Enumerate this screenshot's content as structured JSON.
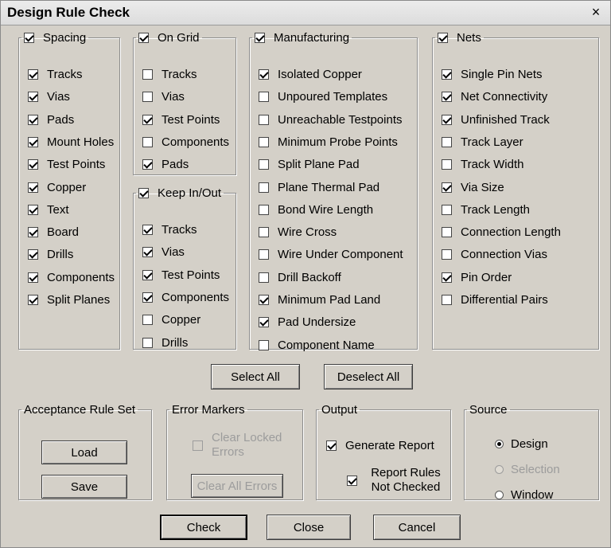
{
  "window": {
    "title": "Design Rule Check",
    "close_glyph": "×"
  },
  "groups": {
    "spacing": {
      "label": "Spacing",
      "checked": true,
      "items": [
        {
          "label": "Tracks",
          "checked": true
        },
        {
          "label": "Vias",
          "checked": true
        },
        {
          "label": "Pads",
          "checked": true
        },
        {
          "label": "Mount Holes",
          "checked": true
        },
        {
          "label": "Test Points",
          "checked": true
        },
        {
          "label": "Copper",
          "checked": true
        },
        {
          "label": "Text",
          "checked": true
        },
        {
          "label": "Board",
          "checked": true
        },
        {
          "label": "Drills",
          "checked": true
        },
        {
          "label": "Components",
          "checked": true
        },
        {
          "label": "Split Planes",
          "checked": true
        }
      ]
    },
    "on_grid": {
      "label": "On Grid",
      "checked": true,
      "items": [
        {
          "label": "Tracks",
          "checked": false
        },
        {
          "label": "Vias",
          "checked": false
        },
        {
          "label": "Test Points",
          "checked": true
        },
        {
          "label": "Components",
          "checked": false
        },
        {
          "label": "Pads",
          "checked": true
        }
      ]
    },
    "keep_in_out": {
      "label": "Keep In/Out",
      "checked": true,
      "items": [
        {
          "label": "Tracks",
          "checked": true
        },
        {
          "label": "Vias",
          "checked": true
        },
        {
          "label": "Test Points",
          "checked": true
        },
        {
          "label": "Components",
          "checked": true
        },
        {
          "label": "Copper",
          "checked": false
        },
        {
          "label": "Drills",
          "checked": false
        }
      ]
    },
    "manufacturing": {
      "label": "Manufacturing",
      "checked": true,
      "items": [
        {
          "label": "Isolated Copper",
          "checked": true
        },
        {
          "label": "Unpoured Templates",
          "checked": false
        },
        {
          "label": "Unreachable Testpoints",
          "checked": false
        },
        {
          "label": "Minimum Probe Points",
          "checked": false
        },
        {
          "label": "Split Plane Pad",
          "checked": false
        },
        {
          "label": "Plane Thermal Pad",
          "checked": false
        },
        {
          "label": "Bond Wire Length",
          "checked": false
        },
        {
          "label": "Wire Cross",
          "checked": false
        },
        {
          "label": "Wire Under Component",
          "checked": false
        },
        {
          "label": "Drill Backoff",
          "checked": false
        },
        {
          "label": "Minimum Pad Land",
          "checked": true
        },
        {
          "label": "Pad Undersize",
          "checked": true
        },
        {
          "label": "Component Name",
          "checked": false
        }
      ]
    },
    "nets": {
      "label": "Nets",
      "checked": true,
      "items": [
        {
          "label": "Single Pin Nets",
          "checked": true
        },
        {
          "label": "Net Connectivity",
          "checked": true
        },
        {
          "label": "Unfinished Track",
          "checked": true
        },
        {
          "label": "Track Layer",
          "checked": false
        },
        {
          "label": "Track Width",
          "checked": false
        },
        {
          "label": "Via Size",
          "checked": true
        },
        {
          "label": "Track Length",
          "checked": false
        },
        {
          "label": "Connection Length",
          "checked": false
        },
        {
          "label": "Connection Vias",
          "checked": false
        },
        {
          "label": "Pin Order",
          "checked": true
        },
        {
          "label": "Differential Pairs",
          "checked": false
        }
      ]
    }
  },
  "select_buttons": {
    "select_all": "Select All",
    "deselect_all": "Deselect All"
  },
  "acceptance": {
    "label": "Acceptance Rule Set",
    "load": "Load",
    "save": "Save"
  },
  "error_markers": {
    "label": "Error Markers",
    "clear_locked": "Clear Locked Errors",
    "clear_locked_checked": false,
    "clear_all": "Clear All Errors"
  },
  "output": {
    "label": "Output",
    "generate_report": "Generate Report",
    "generate_report_checked": true,
    "report_rules": "Report Rules Not Checked",
    "report_rules_checked": true
  },
  "source": {
    "label": "Source",
    "options": [
      "Design",
      "Selection",
      "Window"
    ],
    "selected": "Design",
    "disabled": [
      "Selection"
    ]
  },
  "actions": {
    "check": "Check",
    "close": "Close",
    "cancel": "Cancel"
  }
}
